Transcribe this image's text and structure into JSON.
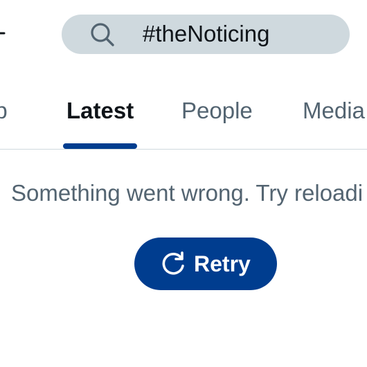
{
  "header": {
    "back_icon": "arrow-left-icon",
    "search": {
      "icon": "search-icon",
      "value": "#theNoticing"
    }
  },
  "tabs": [
    {
      "label": "Top",
      "visible_text": "op",
      "selected": false
    },
    {
      "label": "Latest",
      "visible_text": "Latest",
      "selected": true
    },
    {
      "label": "People",
      "visible_text": "People",
      "selected": false
    },
    {
      "label": "Media",
      "visible_text": "Media",
      "selected": false
    }
  ],
  "main": {
    "error_message": "Something went wrong. Try reloadi",
    "retry_button": {
      "icon": "refresh-icon",
      "label": "Retry"
    }
  },
  "colors": {
    "accent": "#003d8f",
    "search_bg": "#cfd9de",
    "text_primary": "#0f1419",
    "text_secondary": "#536471",
    "divider": "#cfd9de"
  }
}
